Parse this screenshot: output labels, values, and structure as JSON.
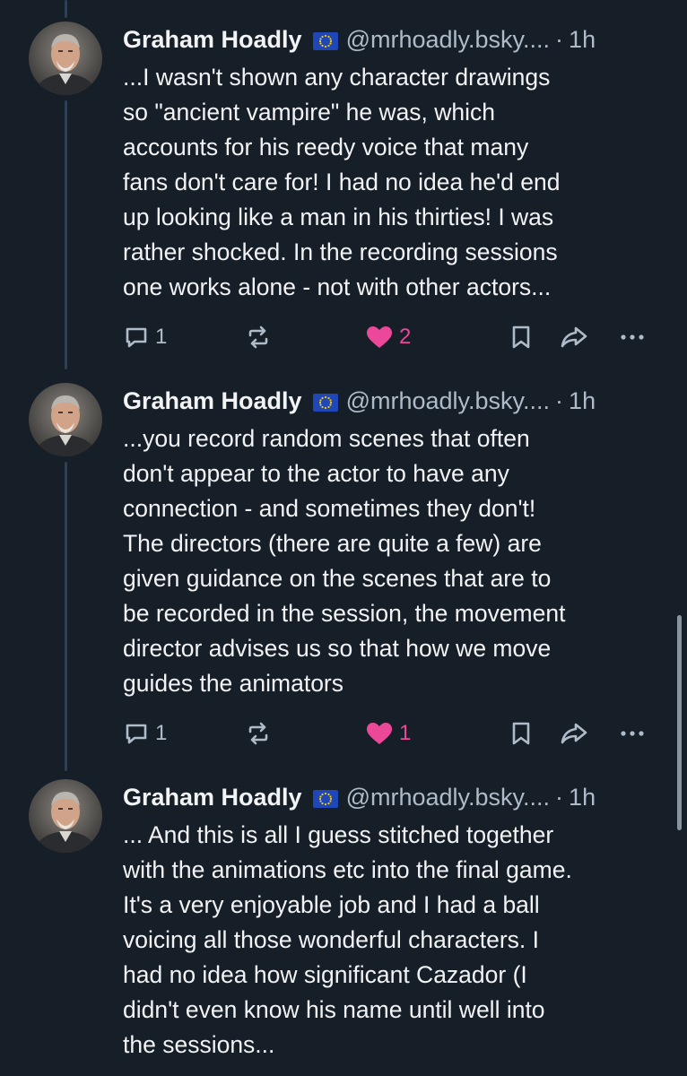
{
  "posts": [
    {
      "author": "Graham Hoadly",
      "handle": "@mrhoadly.bsky....",
      "separator": "·",
      "time": "1h",
      "text": "...I wasn't shown any character drawings\nso \"ancient vampire\" he was, which\naccounts for his reedy voice that many\nfans don't care for! I had no idea he'd end\nup looking like a man in his thirties! I was\nrather shocked. In the recording sessions\none works alone - not with other actors...",
      "reply_count": "1",
      "repost_count": "",
      "like_count": "2",
      "liked": true
    },
    {
      "author": "Graham Hoadly",
      "handle": "@mrhoadly.bsky....",
      "separator": "·",
      "time": "1h",
      "text": "...you record random scenes that often\ndon't appear to the actor to have any\nconnection - and sometimes they don't!\nThe directors (there are quite a few) are\ngiven guidance on the scenes that are to\nbe recorded in the session, the movement\ndirector advises us so that how we move\nguides the animators",
      "reply_count": "1",
      "repost_count": "",
      "like_count": "1",
      "liked": true
    },
    {
      "author": "Graham Hoadly",
      "handle": "@mrhoadly.bsky....",
      "separator": "·",
      "time": "1h",
      "text": "... And this is all I guess stitched together\nwith the animations etc into the final game.\nIt's a very enjoyable job and I had a ball\nvoicing all those wonderful characters. I\nhad no idea how significant Cazador (I\ndidn't even know his name until well into\nthe sessions..."
    }
  ],
  "icons": {
    "flag": "eu-flag-icon",
    "reply": "reply-bubble-icon",
    "repost": "repost-icon",
    "like": "heart-icon",
    "bookmark": "bookmark-icon",
    "share": "share-arrow-icon",
    "more": "more-dots-icon"
  },
  "colors": {
    "background": "#161e27",
    "text": "#f1f3f5",
    "muted": "#aebbc9",
    "like": "#ec4899",
    "thread_line": "#2e4052"
  }
}
